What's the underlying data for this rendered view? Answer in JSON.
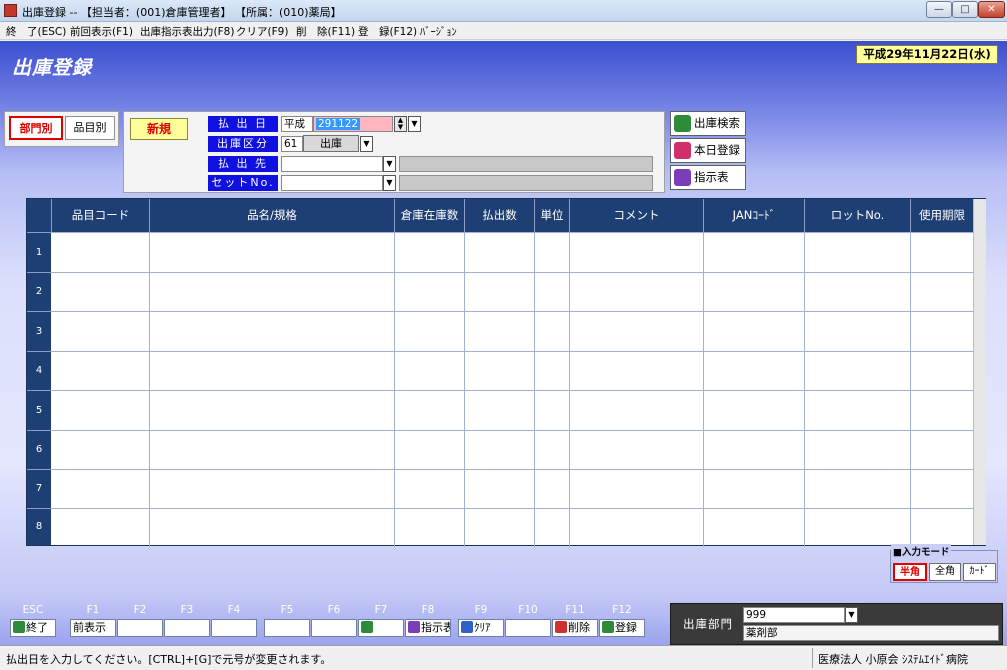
{
  "window": {
    "title": "出庫登録 -- 【担当者：(001)倉庫管理者】 【所属：(010)薬局】",
    "min_glyph": "—",
    "max_glyph": "□",
    "close_glyph": "✕"
  },
  "menu": [
    {
      "label": "終　了(ESC)"
    },
    {
      "label": "前回表示(F1)"
    },
    {
      "label": "出庫指示表出力(F8)"
    },
    {
      "label": "クリア(F9)"
    },
    {
      "label": "削　除(F11)"
    },
    {
      "label": "登　録(F12)"
    },
    {
      "label": "ﾊﾞｰｼﾞｮﾝ"
    }
  ],
  "header": {
    "screen_title": "出庫登録",
    "date": "平成29年11月22日(水)"
  },
  "tabs": [
    {
      "label": "部門別",
      "selected": true
    },
    {
      "label": "品目別",
      "selected": false
    }
  ],
  "form": {
    "mode_badge": "新規",
    "payout_date_label": "払 出 日",
    "era": "平成",
    "payout_date_value": "291122",
    "shipment_type_label": "出庫区分",
    "shipment_type_code": "61",
    "shipment_type_button": "出庫",
    "payout_dest_label": "払 出 先",
    "payout_dest_value": "",
    "payout_dest_name": "",
    "set_no_label": "セットNo.",
    "set_no_value": "",
    "set_no_name": ""
  },
  "side_buttons": [
    {
      "label": "出庫検索",
      "icon": "magnifier-icon",
      "color": "#2e8b3a"
    },
    {
      "label": "本日登録",
      "icon": "register-icon",
      "color": "#d0306a"
    },
    {
      "label": "指示表",
      "icon": "instruction-sheet-icon",
      "color": "#7a3fb8"
    }
  ],
  "table": {
    "columns": [
      "品目コード",
      "品名/規格",
      "倉庫在庫数",
      "払出数",
      "単位",
      "コメント",
      "JANｺｰﾄﾞ",
      "ロットNo.",
      "使用期限"
    ],
    "row_numbers": [
      "1",
      "2",
      "3",
      "4",
      "5",
      "6",
      "7",
      "8"
    ]
  },
  "input_mode": {
    "label": "■入力モード",
    "options": [
      {
        "label": "半角",
        "selected": true
      },
      {
        "label": "全角",
        "selected": false
      },
      {
        "label": "ｶｰﾄﾞ",
        "selected": false
      }
    ]
  },
  "function_keys": [
    {
      "key": "ESC",
      "label": "終了",
      "icon": "exit-icon"
    },
    {
      "key": "F1",
      "label": "前表示",
      "icon": ""
    },
    {
      "key": "F2",
      "label": "",
      "icon": ""
    },
    {
      "key": "F3",
      "label": "",
      "icon": ""
    },
    {
      "key": "F4",
      "label": "",
      "icon": ""
    },
    {
      "key": "F5",
      "label": "",
      "icon": ""
    },
    {
      "key": "F6",
      "label": "",
      "icon": ""
    },
    {
      "key": "F7",
      "label": "",
      "icon": "search-icon"
    },
    {
      "key": "F8",
      "label": "指示表",
      "icon": "instruction-sheet-icon"
    },
    {
      "key": "F9",
      "label": "ｸﾘｱ",
      "icon": "clear-icon"
    },
    {
      "key": "F10",
      "label": "",
      "icon": ""
    },
    {
      "key": "F11",
      "label": "削除",
      "icon": "delete-icon"
    },
    {
      "key": "F12",
      "label": "登録",
      "icon": "save-icon"
    }
  ],
  "department": {
    "label": "出庫部門",
    "code": "999",
    "name": "薬剤部"
  },
  "status": {
    "message": "払出日を入力してください。[CTRL]+[G]で元号が変更されます。",
    "organization": "医療法人 小原会 ｼｽﾃﾑｴｲﾄﾞ病院"
  },
  "colors": {
    "accent_blue": "#1010e0",
    "grid_header": "#1e3f73",
    "highlight_yellow": "#fffe99",
    "selected_red": "#e00000"
  }
}
